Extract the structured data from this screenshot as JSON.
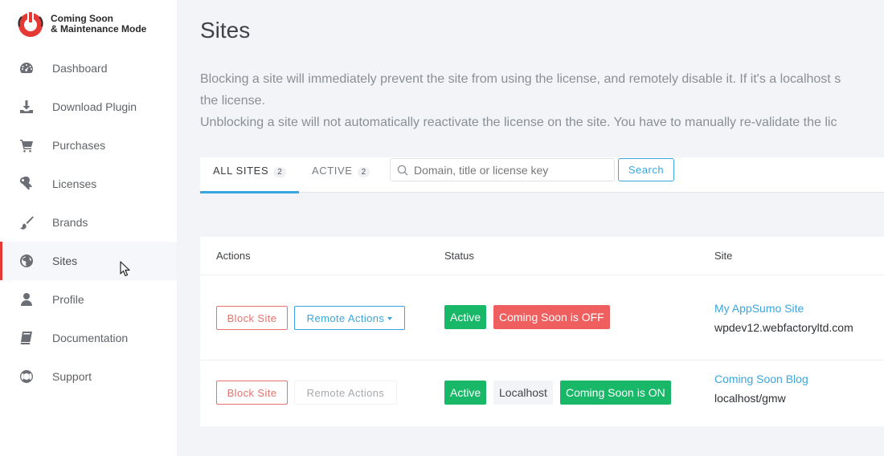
{
  "brand": {
    "line1": "Coming Soon",
    "line2": "& Maintenance Mode",
    "logo_color": "#e53935"
  },
  "sidebar": {
    "items": [
      {
        "label": "Dashboard",
        "icon": "dashboard-icon"
      },
      {
        "label": "Download Plugin",
        "icon": "download-icon"
      },
      {
        "label": "Purchases",
        "icon": "cart-icon"
      },
      {
        "label": "Licenses",
        "icon": "key-icon"
      },
      {
        "label": "Brands",
        "icon": "brush-icon"
      },
      {
        "label": "Sites",
        "icon": "globe-icon",
        "active": true
      },
      {
        "label": "Profile",
        "icon": "user-icon"
      },
      {
        "label": "Documentation",
        "icon": "book-icon"
      },
      {
        "label": "Support",
        "icon": "lifebuoy-icon"
      }
    ],
    "active_color": "#e53935"
  },
  "page": {
    "title": "Sites",
    "desc_line1": "Blocking a site will immediately prevent the site from using the license, and remotely disable it. If it's a localhost s",
    "desc_line2": "the license.",
    "desc_line3": "Unblocking a site will not automatically reactivate the license on the site. You have to manually re-validate the lic"
  },
  "tabs": {
    "all": {
      "label": "ALL SITES",
      "count": "2"
    },
    "active": {
      "label": "ACTIVE",
      "count": "2"
    }
  },
  "search": {
    "placeholder": "Domain, title or license key",
    "value": "",
    "button_label": "Search"
  },
  "table": {
    "headers": {
      "actions": "Actions",
      "status": "Status",
      "site": "Site"
    },
    "rows": [
      {
        "block_label": "Block Site",
        "remote_label": "Remote Actions",
        "status_active": "Active",
        "status_mode": "Coming Soon is OFF",
        "site_title": "My AppSumo Site",
        "site_domain": "wpdev12.webfactoryltd.com"
      },
      {
        "block_label": "Block Site",
        "remote_label": "Remote Actions",
        "status_active": "Active",
        "status_local": "Localhost",
        "status_mode": "Coming Soon is ON",
        "site_title": "Coming Soon Blog",
        "site_domain": "localhost/gmw"
      }
    ]
  },
  "colors": {
    "accent": "#3aa6e0",
    "danger": "#e5736f",
    "success": "#19b869",
    "off": "#f05f5f"
  }
}
